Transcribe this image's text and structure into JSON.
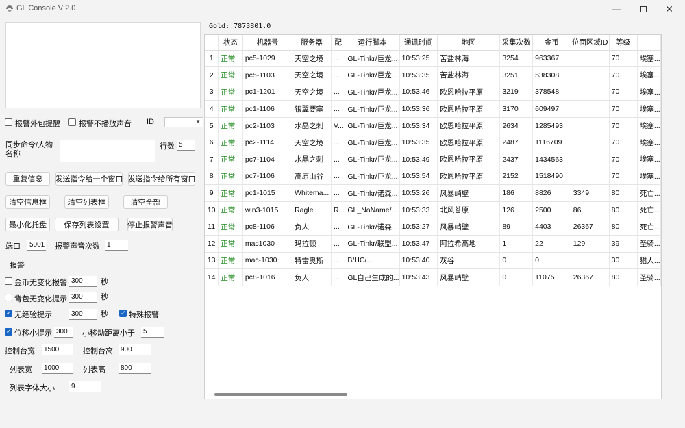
{
  "window": {
    "title": "GL Console V 2.0"
  },
  "gold": {
    "label": "Gold:",
    "value": "7873801.0"
  },
  "options": {
    "alarm_bag": "报警外包提醒",
    "alarm_no_sound": "报警不播放声音",
    "id_label": "ID",
    "sync_cmd_label": "同步命令/人物名称",
    "rows_label": "行数",
    "rows_value": "5",
    "port_label": "端口",
    "port_value": "5001",
    "alarm_count_label": "报警声音次数",
    "alarm_count_value": "1",
    "alarm_section": "报警",
    "gold_no_change": "金币无变化报警",
    "gold_no_change_value": "300",
    "bag_no_change": "背包无变化提示",
    "bag_no_change_value": "300",
    "no_exp": "无经验提示",
    "no_exp_value": "300",
    "sec_unit": "秒",
    "special_alarm": "特殊报警",
    "pos_stuck": "位移小提示",
    "pos_stuck_value": "300",
    "pos_dist_label": "小移动距离小于",
    "pos_dist_value": "5",
    "ctrl_width_label": "控制台宽",
    "ctrl_width_value": "1500",
    "ctrl_height_label": "控制台高",
    "ctrl_height_value": "900",
    "list_width_label": "列表宽",
    "list_width_value": "1000",
    "list_height_label": "列表高",
    "list_height_value": "800",
    "font_size_label": "列表字体大小",
    "font_size_value": "9"
  },
  "buttons": {
    "clear_all": "重复信息",
    "send_one": "发送指令给一个窗口",
    "send_all": "发送指令给所有窗口",
    "clear_info": "清空信息框",
    "clear_list": "清空列表框",
    "clear_everything": "清空全部",
    "minimize_tray": "最小化托盘",
    "save_list": "保存列表设置",
    "stop_alarm": "停止报警声音"
  },
  "table": {
    "headers": [
      "状态",
      "机器号",
      "服务器",
      "配",
      "运行脚本",
      "通讯时间",
      "地图",
      "采集次数",
      "金币",
      "位面区域ID",
      "等级",
      ""
    ],
    "rows": [
      [
        "1",
        "正常",
        "pc5-1029",
        "天空之境",
        "...",
        "GL-Tinkr/巨龙...",
        "10:53:25",
        "苦盐林海",
        "3254",
        "963367",
        "",
        "70",
        "埃塞..."
      ],
      [
        "2",
        "正常",
        "pc5-1103",
        "天空之境",
        "...",
        "GL-Tinkr/巨龙...",
        "10:53:35",
        "苦盐林海",
        "3251",
        "538308",
        "",
        "70",
        "埃塞..."
      ],
      [
        "3",
        "正常",
        "pc1-1201",
        "天空之境",
        "...",
        "GL-Tinkr/巨龙...",
        "10:53:46",
        "欧恩哈拉平原",
        "3219",
        "378548",
        "",
        "70",
        "埃塞..."
      ],
      [
        "4",
        "正常",
        "pc1-1106",
        "银翼要塞",
        "...",
        "GL-Tinkr/巨龙...",
        "10:53:36",
        "欧恩哈拉平原",
        "3170",
        "609497",
        "",
        "70",
        "埃塞..."
      ],
      [
        "5",
        "正常",
        "pc2-1103",
        "水晶之刺",
        "V...",
        "GL-Tinkr/巨龙...",
        "10:53:34",
        "欧恩哈拉平原",
        "2634",
        "1285493",
        "",
        "70",
        "埃塞..."
      ],
      [
        "6",
        "正常",
        "pc2-1114",
        "天空之境",
        "...",
        "GL-Tinkr/巨龙...",
        "10:53:35",
        "欧恩哈拉平原",
        "2487",
        "1116709",
        "",
        "70",
        "埃塞..."
      ],
      [
        "7",
        "正常",
        "pc7-1104",
        "水晶之刺",
        "...",
        "GL-Tinkr/巨龙...",
        "10:53:49",
        "欧恩哈拉平原",
        "2437",
        "1434563",
        "",
        "70",
        "埃塞..."
      ],
      [
        "8",
        "正常",
        "pc7-1106",
        "高原山谷",
        "...",
        "GL-Tinkr/巨龙...",
        "10:53:54",
        "欧恩哈拉平原",
        "2152",
        "1518490",
        "",
        "70",
        "埃塞..."
      ],
      [
        "9",
        "正常",
        "pc1-1015",
        "Whitema...",
        "...",
        "GL-Tinkr/诺森...",
        "10:53:26",
        "风暴峭壁",
        "186",
        "8826",
        "3349",
        "80",
        "死亡..."
      ],
      [
        "10",
        "正常",
        "win3-1015",
        "Ragle",
        "R...",
        "GL_NoName/...",
        "10:53:33",
        "北风苔原",
        "126",
        "2500",
        "86",
        "80",
        "死亡..."
      ],
      [
        "11",
        "正常",
        "pc8-1106",
        "负人",
        "...",
        "GL-Tinkr/诺森...",
        "10:53:27",
        "风暴峭壁",
        "89",
        "4403",
        "26367",
        "80",
        "死亡..."
      ],
      [
        "12",
        "正常",
        "mac1030",
        "玛拉顿",
        "...",
        "GL-Tinkr/联盟...",
        "10:53:47",
        "阿拉希高地",
        "1",
        "22",
        "129",
        "39",
        "圣骑..."
      ],
      [
        "13",
        "正常",
        "mac-1030",
        "特雷奥斯",
        "...",
        "B/HC/...",
        "10:53:40",
        "灰谷",
        "0",
        "0",
        "",
        "30",
        "猎人..."
      ],
      [
        "14",
        "正常",
        "pc8-1016",
        "负人",
        "...",
        "GL自己生成的...",
        "10:53:43",
        "风暴峭壁",
        "0",
        "11075",
        "26367",
        "80",
        "圣骑..."
      ]
    ]
  },
  "colors": {
    "status_ok": "#1e8a1e",
    "accent": "#1a66c4"
  }
}
